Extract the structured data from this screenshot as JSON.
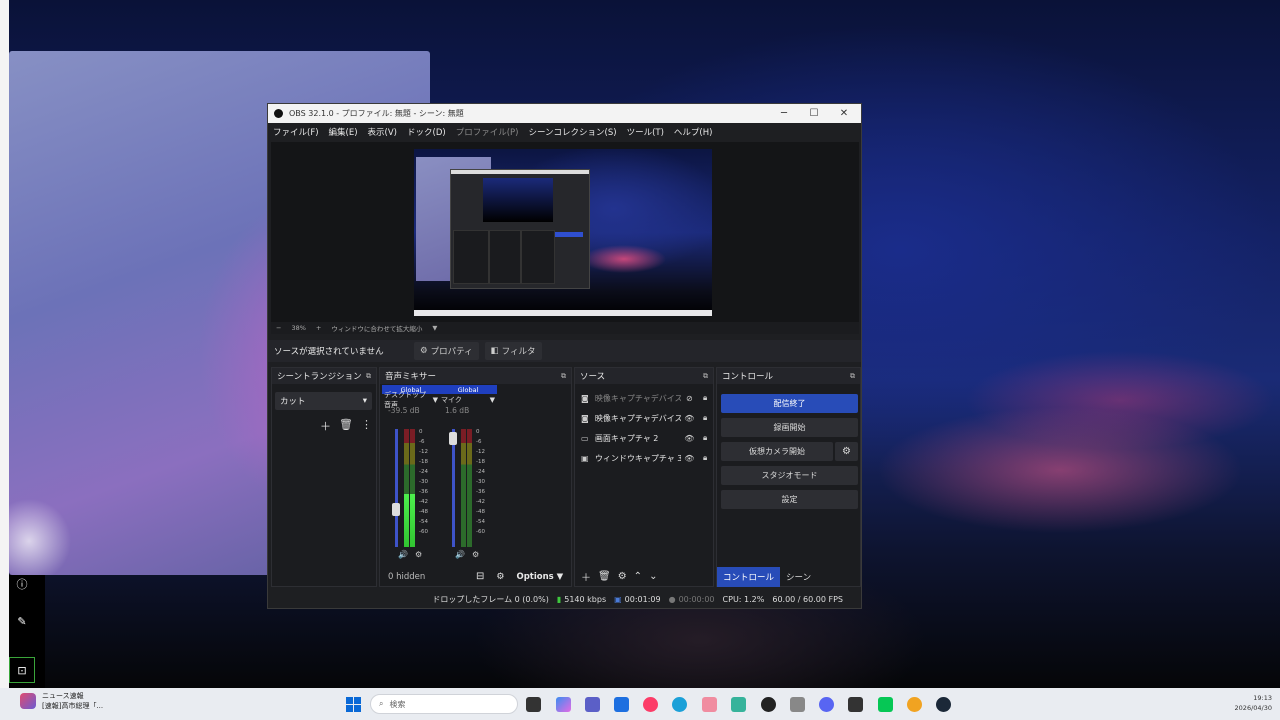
{
  "obs": {
    "title": "OBS 32.1.0 - プロファイル: 無題 - シーン: 無題",
    "window_controls": {
      "minimize": "─",
      "maximize": "☐",
      "close": "✕"
    },
    "menu": [
      {
        "label": "ファイル(F)",
        "enabled": true
      },
      {
        "label": "編集(E)",
        "enabled": true
      },
      {
        "label": "表示(V)",
        "enabled": true
      },
      {
        "label": "ドック(D)",
        "enabled": true
      },
      {
        "label": "プロファイル(P)",
        "enabled": false
      },
      {
        "label": "シーンコレクション(S)",
        "enabled": true
      },
      {
        "label": "ツール(T)",
        "enabled": true
      },
      {
        "label": "ヘルプ(H)",
        "enabled": true
      }
    ],
    "zoom_bar": {
      "minus": "−",
      "zoom": "38%",
      "plus": "+",
      "fit_label": "ウィンドウに合わせて拡大縮小",
      "dropdown": "▼"
    },
    "source_toolbar": {
      "status": "ソースが選択されていません",
      "properties": "プロパティ",
      "filters": "フィルタ"
    },
    "transition": {
      "header": "シーントランジション",
      "selected": "カット"
    },
    "mixer": {
      "header": "音声ミキサー",
      "channels": [
        {
          "badge": "Global",
          "name": "デスクトップ音声",
          "db": "-39.5 dB",
          "fader": 0.3,
          "level": 0.45
        },
        {
          "badge": "Global",
          "name": "マイク",
          "db": "1.6 dB",
          "fader": 0.97,
          "level": 0.0
        }
      ],
      "scale": [
        "0",
        "-6",
        "-12",
        "-18",
        "-24",
        "-30",
        "-36",
        "-42",
        "-48",
        "-54",
        "-60"
      ],
      "hidden": "0 hidden",
      "options": "Options"
    },
    "sources": {
      "header": "ソース",
      "items": [
        {
          "icon": "camera-icon",
          "label": "映像キャプチャデバイス",
          "visible": false
        },
        {
          "icon": "camera-icon",
          "label": "映像キャプチャデバイス",
          "visible": true
        },
        {
          "icon": "monitor-icon",
          "label": "画面キャプチャ 2",
          "visible": true
        },
        {
          "icon": "window-icon",
          "label": "ウィンドウキャプチャ 3",
          "visible": true
        }
      ]
    },
    "controls": {
      "header": "コントロール",
      "stop_stream": "配信終了",
      "start_record": "録画開始",
      "virtual_cam": "仮想カメラ開始",
      "studio_mode": "スタジオモード",
      "settings": "設定",
      "tab_controls": "コントロール",
      "tab_scenes": "シーン"
    },
    "status": {
      "dropped": "ドロップしたフレーム 0 (0.0%)",
      "bitrate": "5140 kbps",
      "stream_time": "00:01:09",
      "record_time": "00:00:00",
      "cpu": "CPU: 1.2%",
      "fps": "60.00 / 60.00 FPS"
    }
  },
  "taskbar": {
    "news_line1": "ニュース速報",
    "news_line2": "[速報]高市総理「...",
    "search_placeholder": "検索",
    "time": "19:13",
    "date": "2026/04/30"
  },
  "colors": {
    "accent": "#284cb8",
    "mixer_badge": "#1f3fbf",
    "meter_green": "#4df04d"
  }
}
